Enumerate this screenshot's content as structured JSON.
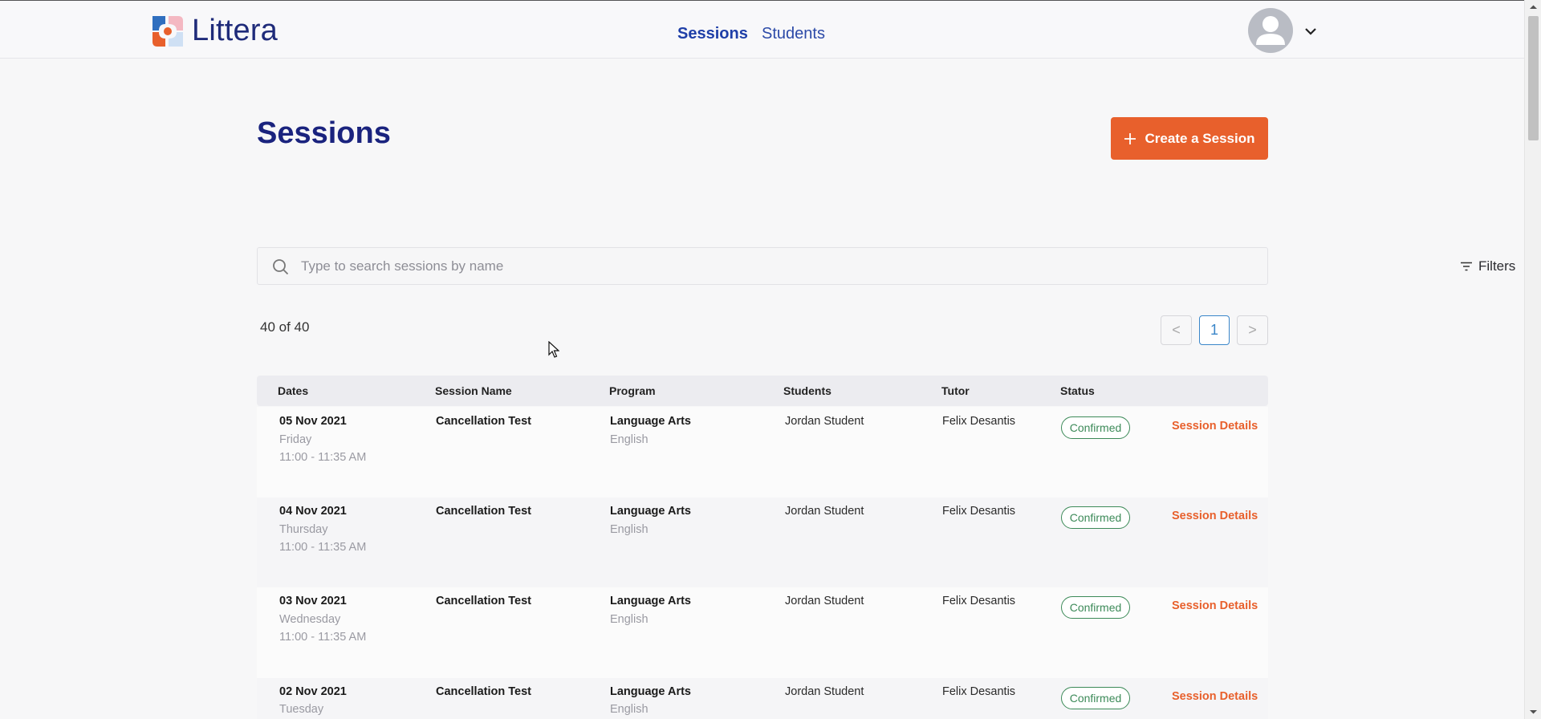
{
  "app": {
    "name": "Littera"
  },
  "nav": {
    "items": [
      {
        "label": "Sessions",
        "active": true
      },
      {
        "label": "Students",
        "active": false
      }
    ]
  },
  "page": {
    "title": "Sessions",
    "create_button": "Create a Session"
  },
  "search": {
    "placeholder": "Type to search sessions by name",
    "value": "",
    "filters_label": "Filters"
  },
  "results": {
    "count_text": "40 of 40"
  },
  "pagination": {
    "prev": "<",
    "current": "1",
    "next": ">"
  },
  "table": {
    "columns": [
      "Dates",
      "Session Name",
      "Program",
      "Students",
      "Tutor",
      "Status"
    ],
    "rows": [
      {
        "date": "05 Nov 2021",
        "weekday": "Friday",
        "time": "11:00 - 11:35 AM",
        "session_name": "Cancellation Test",
        "program": "Language Arts",
        "subject": "English",
        "students": "Jordan Student",
        "tutor": "Felix Desantis",
        "status": "Confirmed",
        "action": "Session Details"
      },
      {
        "date": "04 Nov 2021",
        "weekday": "Thursday",
        "time": "11:00 - 11:35 AM",
        "session_name": "Cancellation Test",
        "program": "Language Arts",
        "subject": "English",
        "students": "Jordan Student",
        "tutor": "Felix Desantis",
        "status": "Confirmed",
        "action": "Session Details"
      },
      {
        "date": "03 Nov 2021",
        "weekday": "Wednesday",
        "time": "11:00 - 11:35 AM",
        "session_name": "Cancellation Test",
        "program": "Language Arts",
        "subject": "English",
        "students": "Jordan Student",
        "tutor": "Felix Desantis",
        "status": "Confirmed",
        "action": "Session Details"
      },
      {
        "date": "02 Nov 2021",
        "weekday": "Tuesday",
        "time": "",
        "session_name": "Cancellation Test",
        "program": "Language Arts",
        "subject": "English",
        "students": "Jordan Student",
        "tutor": "Felix Desantis",
        "status": "Confirmed",
        "action": "Session Details"
      }
    ]
  },
  "colors": {
    "brand_navy": "#1a237e",
    "accent_orange": "#e8602c",
    "status_green": "#3c8a58",
    "link_blue": "#1f3fa8"
  },
  "icons": {
    "search": "search-icon",
    "filters": "filter-lines-icon",
    "avatar": "user-avatar-icon",
    "chevron": "chevron-down-icon",
    "plus": "plus-icon"
  }
}
